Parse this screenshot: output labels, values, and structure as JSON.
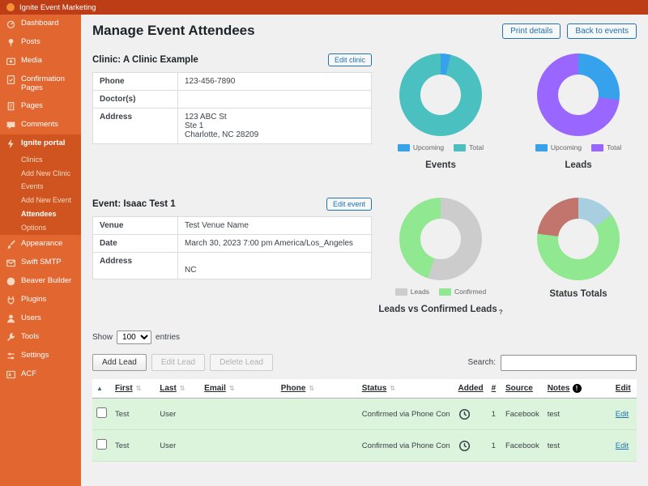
{
  "admin_bar": {
    "site_name": "Ignite Event Marketing"
  },
  "sidebar": {
    "items_top": [
      {
        "label": "Dashboard"
      },
      {
        "label": "Posts"
      },
      {
        "label": "Media"
      },
      {
        "label": "Confirmation Pages"
      },
      {
        "label": "Pages"
      },
      {
        "label": "Comments"
      }
    ],
    "portal": {
      "label": "Ignite portal",
      "submenu": [
        {
          "label": "Clinics"
        },
        {
          "label": "Add New Clinic"
        },
        {
          "label": "Events"
        },
        {
          "label": "Add New Event"
        },
        {
          "label": "Attendees",
          "active": true
        },
        {
          "label": "Options"
        }
      ]
    },
    "items_bottom": [
      {
        "label": "Appearance"
      },
      {
        "label": "Swift SMTP"
      },
      {
        "label": "Beaver Builder"
      },
      {
        "label": "Plugins"
      },
      {
        "label": "Users"
      },
      {
        "label": "Tools"
      },
      {
        "label": "Settings"
      },
      {
        "label": "ACF"
      }
    ]
  },
  "page": {
    "title": "Manage Event Attendees",
    "print_button": "Print details",
    "back_button": "Back to events"
  },
  "clinic": {
    "heading": "Clinic: A Clinic Example",
    "edit_button": "Edit clinic",
    "rows": [
      {
        "label": "Phone",
        "value": "123-456-7890"
      },
      {
        "label": "Doctor(s)",
        "value": ""
      },
      {
        "label": "Address",
        "value": "123 ABC St\nSte 1\nCharlotte, NC 28209"
      }
    ]
  },
  "event": {
    "heading": "Event: Isaac Test 1",
    "edit_button": "Edit event",
    "rows": [
      {
        "label": "Venue",
        "value": "Test Venue Name"
      },
      {
        "label": "Date",
        "value": "March 30, 2023 7:00 pm America/Los_Angeles"
      },
      {
        "label": "Address",
        "value": "\nNC"
      }
    ]
  },
  "chart_data": [
    {
      "type": "pie",
      "donut": true,
      "title": "Events",
      "labels": [
        "Upcoming",
        "Total"
      ],
      "values": [
        4,
        96
      ],
      "colors": [
        "#36a2eb",
        "#4bc0c0"
      ],
      "legend_position": "bottom"
    },
    {
      "type": "pie",
      "donut": true,
      "title": "Leads",
      "labels": [
        "Upcoming",
        "Total"
      ],
      "values": [
        27,
        73
      ],
      "colors": [
        "#36a2eb",
        "#9966ff"
      ],
      "legend_position": "bottom"
    },
    {
      "type": "pie",
      "donut": true,
      "title": "Leads vs Confirmed Leads",
      "help": "?",
      "labels": [
        "Leads",
        "Confirmed"
      ],
      "values": [
        55,
        45
      ],
      "colors": [
        "#cccccc",
        "#90e890"
      ],
      "legend_position": "bottom"
    },
    {
      "type": "pie",
      "donut": true,
      "title": "Status Totals",
      "labels": [],
      "values": [
        15,
        62,
        23
      ],
      "colors": [
        "#a8cfe0",
        "#90e890",
        "#c2756d"
      ],
      "legend_position": "none"
    }
  ],
  "table_controls": {
    "show_label": "Show",
    "page_length": "100",
    "entries_label": "entries",
    "add_lead": "Add Lead",
    "edit_lead": "Edit Lead",
    "delete_lead": "Delete Lead",
    "search_label": "Search:",
    "search_value": ""
  },
  "leads_table": {
    "sort_indicator": "▲",
    "sort_icon": "⇅",
    "notes_info": "!",
    "columns": [
      "First",
      "Last",
      "Email",
      "Phone",
      "Status",
      "Added",
      "#",
      "Source",
      "Notes",
      "Edit"
    ],
    "rows": [
      {
        "first": "Test",
        "last": "User",
        "email": "",
        "phone": "",
        "status": "Confirmed via Phone Con",
        "number": "1",
        "source": "Facebook",
        "notes": "test",
        "edit": "Edit"
      },
      {
        "first": "Test",
        "last": "User",
        "email": "",
        "phone": "",
        "status": "Confirmed via Phone Con",
        "number": "1",
        "source": "Facebook",
        "notes": "test",
        "edit": "Edit"
      }
    ]
  }
}
